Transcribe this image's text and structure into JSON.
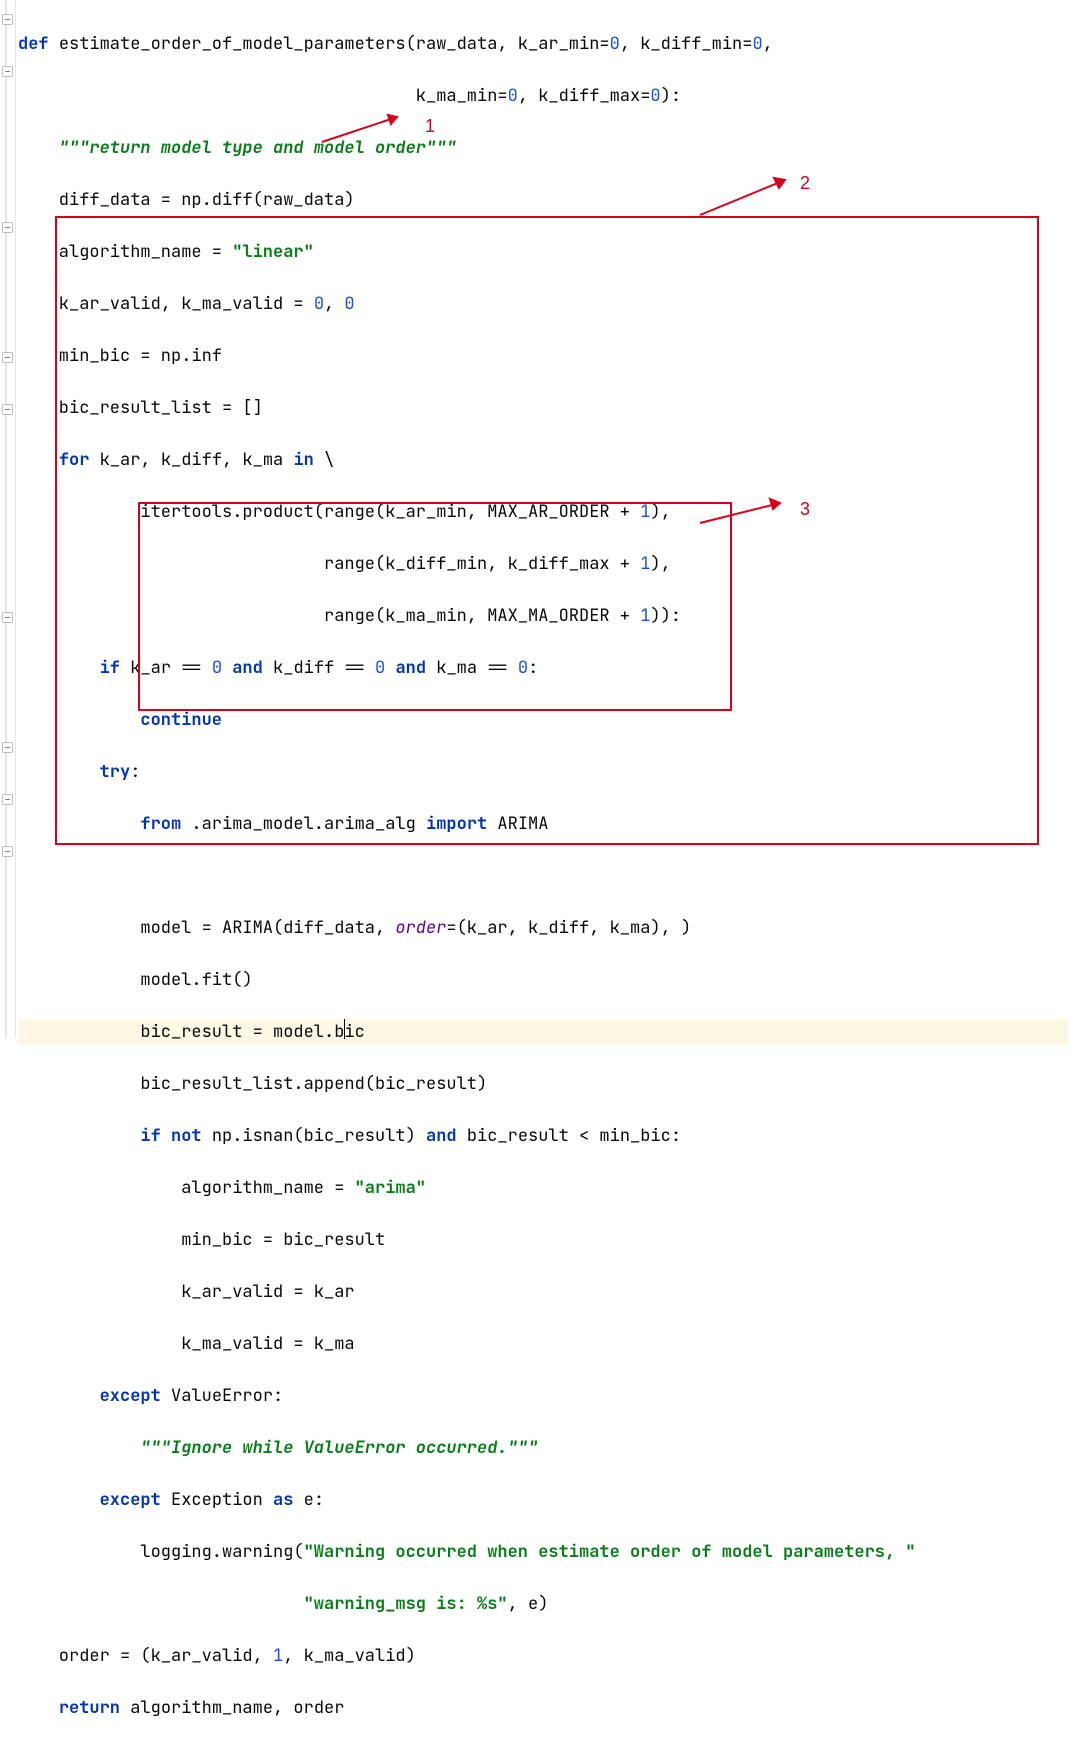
{
  "lines": {
    "l1a": "def ",
    "l1b": "estimate_order_of_model_parameters(raw_data, k_ar_min=",
    "l1c": "0",
    "l1d": ", k_diff_min=",
    "l1e": "0",
    "l1f": ",",
    "l2a": "                                       k_ma_min=",
    "l2b": "0",
    "l2c": ", k_diff_max=",
    "l2d": "0",
    "l2e": "):",
    "l3": "    \"\"\"return model type and model order\"\"\"",
    "l4": "    diff_data = np.diff(raw_data)",
    "l5a": "    algorithm_name = ",
    "l5b": "\"linear\"",
    "l6a": "    k_ar_valid, k_ma_valid = ",
    "l6b": "0",
    "l6c": ", ",
    "l6d": "0",
    "l7": "    min_bic = np.inf",
    "l8": "    bic_result_list = []",
    "l9a": "    ",
    "l9b": "for ",
    "l9c": "k_ar, k_diff, k_ma ",
    "l9d": "in ",
    "l9e": "\\",
    "l10a": "            itertools.product(range(k_ar_min, MAX_AR_ORDER + ",
    "l10b": "1",
    "l10c": "),",
    "l11a": "                              range(k_diff_min, k_diff_max + ",
    "l11b": "1",
    "l11c": "),",
    "l12a": "                              range(k_ma_min, MAX_MA_ORDER + ",
    "l12b": "1",
    "l12c": ")):",
    "l13a": "        ",
    "l13b": "if ",
    "l13c": "k_ar == ",
    "l13d": "0 ",
    "l13e": "and ",
    "l13f": "k_diff == ",
    "l13g": "0 ",
    "l13h": "and ",
    "l13i": "k_ma == ",
    "l13j": "0",
    "l13k": ":",
    "l14a": "            ",
    "l14b": "continue",
    "l15a": "        ",
    "l15b": "try",
    "l15c": ":",
    "l16a": "            ",
    "l16b": "from ",
    "l16c": ".arima_model.arima_alg ",
    "l16d": "import ",
    "l16e": "ARIMA",
    "l17": "",
    "l18a": "            model = ARIMA(diff_data, ",
    "l18b": "order",
    "l18c": "=(k_ar, k_diff, k_ma), )",
    "l19": "            model.fit()",
    "l20a": "            bic_result = model.b",
    "l20b": "ic",
    "l21": "            bic_result_list.append(bic_result)",
    "l22a": "            ",
    "l22b": "if not ",
    "l22c": "np.isnan(bic_result) ",
    "l22d": "and ",
    "l22e": "bic_result < min_bic:",
    "l23a": "                algorithm_name = ",
    "l23b": "\"arima\"",
    "l24": "                min_bic = bic_result",
    "l25": "                k_ar_valid = k_ar",
    "l26": "                k_ma_valid = k_ma",
    "l27a": "        ",
    "l27b": "except ",
    "l27c": "ValueError:",
    "l28": "            \"\"\"Ignore while ValueError occurred.\"\"\"",
    "l29a": "        ",
    "l29b": "except ",
    "l29c": "Exception ",
    "l29d": "as ",
    "l29e": "e:",
    "l30a": "            logging.warning(",
    "l30b": "\"Warning occurred when estimate order of model parameters, \"",
    "l31a": "                            ",
    "l31b": "\"warning_msg is: %s\"",
    "l31c": ", e)",
    "l32a": "    order = (k_ar_valid, ",
    "l32b": "1",
    "l32c": ", k_ma_valid)",
    "l33a": "    ",
    "l33b": "return ",
    "l33c": "algorithm_name, order"
  },
  "annotations": {
    "a1": "1",
    "a2": "2",
    "a3": "3"
  }
}
